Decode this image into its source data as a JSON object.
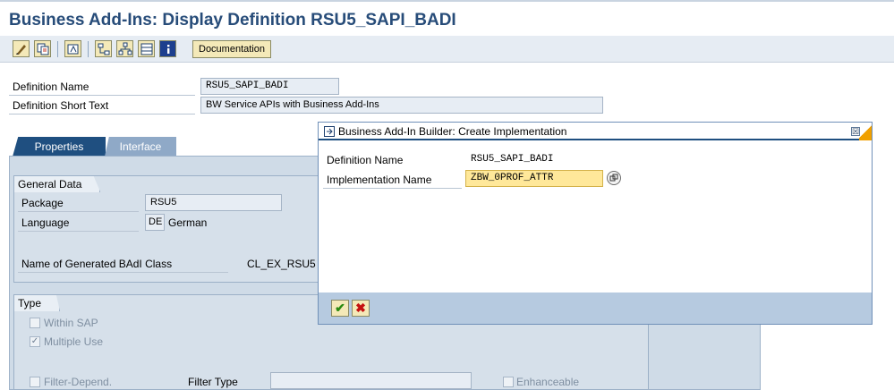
{
  "window": {
    "title": "Business Add-Ins: Display Definition RSU5_SAPI_BADI"
  },
  "toolbar": {
    "icons": [
      "edit-icon",
      "copy-icon",
      "object-list-icon",
      "where-used-icon",
      "hierarchy-icon",
      "layout-icon",
      "info-icon"
    ],
    "documentation_label": "Documentation"
  },
  "definition": {
    "name_label": "Definition Name",
    "name_value": "RSU5_SAPI_BADI",
    "short_text_label": "Definition Short Text",
    "short_text_value": "BW Service APIs with Business Add-Ins"
  },
  "tabs": [
    {
      "label": "Properties",
      "active": true
    },
    {
      "label": "Interface",
      "active": false
    }
  ],
  "general_data": {
    "title": "General Data",
    "package_label": "Package",
    "package_value": "RSU5",
    "language_label": "Language",
    "language_code": "DE",
    "language_name": "German",
    "badi_class_label": "Name of Generated BAdI Class",
    "badi_class_value": "CL_EX_RSU5"
  },
  "type_group": {
    "title": "Type",
    "within_sap": {
      "label": "Within SAP",
      "checked": false
    },
    "multiple_use": {
      "label": "Multiple Use",
      "checked": true
    },
    "filter_depend": {
      "label": "Filter-Depend.",
      "checked": false
    },
    "filter_type_label": "Filter Type",
    "filter_type_value": "",
    "enhanceable": {
      "label": "Enhanceable",
      "checked": false
    }
  },
  "dialog": {
    "title": "Business Add-In Builder: Create Implementation",
    "definition_name_label": "Definition Name",
    "definition_name_value": "RSU5_SAPI_BADI",
    "implementation_name_label": "Implementation Name",
    "implementation_name_value": "ZBW_0PROF_ATTR",
    "confirm_icon": "checkmark-icon",
    "cancel_icon": "cancel-x-icon",
    "close_symbol": "☒"
  },
  "colors": {
    "title_text": "#274c79",
    "tab_active": "#1f4f80",
    "tab_inactive": "#8fa9c7",
    "panel_bg": "#cfdbe7",
    "input_highlight": "#ffe89a",
    "dialog_footer": "#b6cae0"
  }
}
